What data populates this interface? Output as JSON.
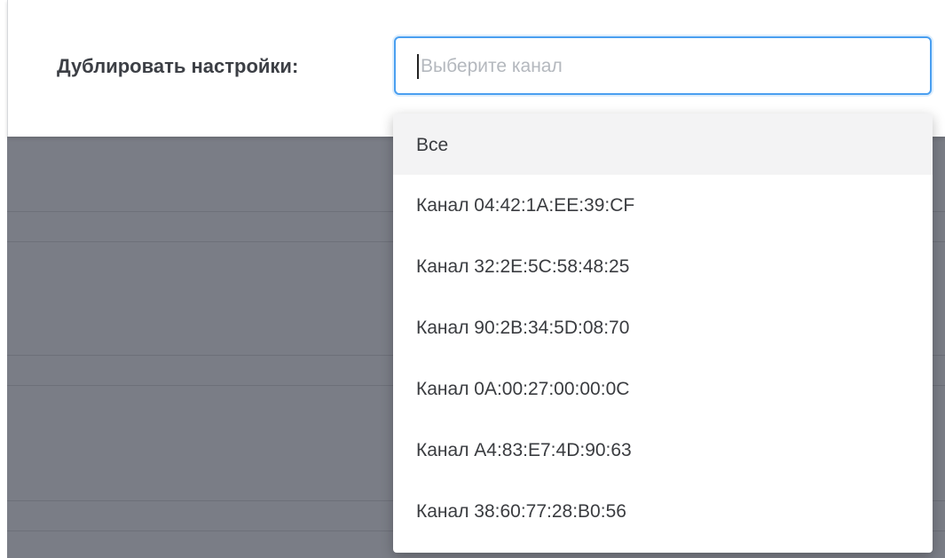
{
  "form": {
    "label": "Дублировать настройки:",
    "select": {
      "placeholder": "Выберите канал",
      "value": ""
    }
  },
  "dropdown": {
    "options": [
      "Все",
      "Канал 04:42:1A:EE:39:CF",
      "Канал 32:2E:5C:58:48:25",
      "Канал 90:2B:34:5D:08:70",
      "Канал 0A:00:27:00:00:0C",
      "Канал A4:83:E7:4D:90:63",
      "Канал 38:60:77:28:B0:56"
    ],
    "highlighted_index": 0
  },
  "colors": {
    "focus_border": "#4a9ff0",
    "overlay": "#7a7d86"
  }
}
